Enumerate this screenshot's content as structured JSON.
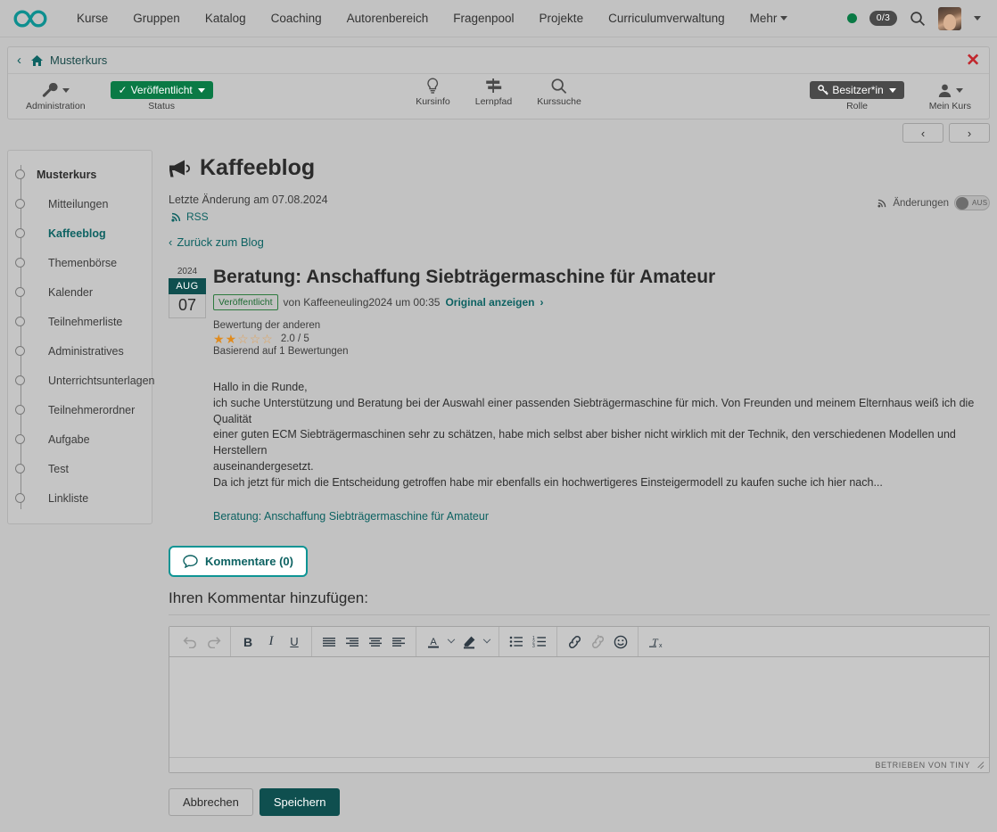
{
  "topnav": {
    "logo_icon": "infinity-logo",
    "items": [
      {
        "label": "Kurse",
        "has_caret": false
      },
      {
        "label": "Gruppen",
        "has_caret": false
      },
      {
        "label": "Katalog",
        "has_caret": false
      },
      {
        "label": "Coaching",
        "has_caret": false
      },
      {
        "label": "Autorenbereich",
        "has_caret": false
      },
      {
        "label": "Fragenpool",
        "has_caret": false
      },
      {
        "label": "Projekte",
        "has_caret": false
      },
      {
        "label": "Curriculumverwaltung",
        "has_caret": false
      },
      {
        "label": "Mehr",
        "has_caret": true
      }
    ],
    "task_badge": "0/3",
    "search_icon": "search-icon",
    "status_dot_color": "#0a7a45"
  },
  "course_header": {
    "back_icon": "chevron-left-icon",
    "home_icon": "home-icon",
    "course_name": "Musterkurs",
    "close_icon": "close-icon",
    "tools": {
      "administration": {
        "label": "Administration",
        "icon": "wrench-icon"
      },
      "status": {
        "label": "Status",
        "value": "Veröffentlicht",
        "check": "✓"
      },
      "kursinfo": {
        "label": "Kursinfo",
        "icon": "lightbulb-icon"
      },
      "lernpfad": {
        "label": "Lernpfad",
        "icon": "signpost-icon"
      },
      "kurssuche": {
        "label": "Kurssuche",
        "icon": "search-icon"
      },
      "rolle": {
        "label": "Rolle",
        "value": "Besitzer*in",
        "icon": "key-icon"
      },
      "mein_kurs": {
        "label": "Mein Kurs",
        "icon": "person-icon"
      }
    },
    "pager": {
      "prev": "‹",
      "next": "›"
    }
  },
  "sidebar": {
    "items": [
      {
        "label": "Musterkurs",
        "level": "root",
        "active": false
      },
      {
        "label": "Mitteilungen",
        "level": "child",
        "active": false
      },
      {
        "label": "Kaffeeblog",
        "level": "child",
        "active": true
      },
      {
        "label": "Themenbörse",
        "level": "child",
        "active": false
      },
      {
        "label": "Kalender",
        "level": "child",
        "active": false
      },
      {
        "label": "Teilnehmerliste",
        "level": "child",
        "active": false
      },
      {
        "label": "Administratives",
        "level": "child",
        "active": false
      },
      {
        "label": "Unterrichtsunterlagen",
        "level": "child",
        "active": false
      },
      {
        "label": "Teilnehmerordner",
        "level": "child",
        "active": false
      },
      {
        "label": "Aufgabe",
        "level": "child",
        "active": false
      },
      {
        "label": "Test",
        "level": "child",
        "active": false
      },
      {
        "label": "Linkliste",
        "level": "child",
        "active": false
      }
    ]
  },
  "main": {
    "title": "Kaffeeblog",
    "title_icon": "megaphone-icon",
    "last_change": "Letzte Änderung am 07.08.2024",
    "rss_label": "RSS",
    "rss_icon": "rss-icon",
    "changes_label": "Änderungen",
    "changes_icon": "rss-icon",
    "changes_state": "AUS",
    "back_to_blog": "Zurück zum Blog",
    "back_icon": "chevron-left-icon"
  },
  "post": {
    "date": {
      "year": "2024",
      "month": "AUG",
      "day": "07"
    },
    "title": "Beratung: Anschaffung Siebträgermaschine für Amateur",
    "status_badge": "Veröffentlicht",
    "byline": "von Kaffeeneuling2024 um 00:35",
    "original_link": "Original anzeigen",
    "original_link_icon": "chevron-right-icon",
    "rating": {
      "caption": "Bewertung der anderen",
      "value": "2.0 / 5",
      "filled": 2,
      "total": 5,
      "basis": "Basierend auf 1 Bewertungen",
      "star_color": "#e08b1e"
    },
    "text_lines": [
      "Hallo in die Runde,",
      "ich suche Unterstützung und Beratung bei der Auswahl einer passenden Siebträgermaschine für mich. Von Freunden und meinem Elternhaus weiß ich die Qualität",
      "einer guten ECM Siebträgermaschinen sehr zu schätzen, habe mich selbst aber bisher nicht wirklich mit der Technik, den verschiedenen Modellen und Herstellern",
      "auseinandergesetzt.",
      "Da ich jetzt für mich die Entscheidung getroffen habe mir ebenfalls ein hochwertigeres Einsteigermodell zu kaufen suche ich hier nach..."
    ],
    "post_link": "Beratung: Anschaffung Siebträgermaschine für Amateur"
  },
  "comments": {
    "tab_label": "Kommentare (0)",
    "tab_icon": "comment-bubble-icon",
    "tab_accent": "#0e9494",
    "heading": "Ihren Kommentar hinzufügen:"
  },
  "editor": {
    "groups": [
      {
        "buttons": [
          {
            "name": "undo-icon",
            "glyph": "↶",
            "disabled": true
          },
          {
            "name": "redo-icon",
            "glyph": "↷",
            "disabled": true
          }
        ]
      },
      {
        "buttons": [
          {
            "name": "bold-icon",
            "glyph": "B",
            "disabled": false
          },
          {
            "name": "italic-icon",
            "glyph": "I",
            "disabled": false
          },
          {
            "name": "underline-icon",
            "glyph": "U",
            "disabled": false
          }
        ]
      },
      {
        "buttons": [
          {
            "name": "align-justify-icon",
            "glyph": "",
            "disabled": false
          },
          {
            "name": "align-right-icon",
            "glyph": "",
            "disabled": false
          },
          {
            "name": "align-center-icon",
            "glyph": "",
            "disabled": false
          },
          {
            "name": "align-left-icon",
            "glyph": "",
            "disabled": false
          }
        ]
      },
      {
        "buttons": [
          {
            "name": "text-color-icon",
            "glyph": "A",
            "disabled": false
          },
          {
            "name": "text-color-chevron-icon",
            "glyph": "",
            "disabled": false
          },
          {
            "name": "highlight-color-icon",
            "glyph": "",
            "disabled": false
          },
          {
            "name": "highlight-color-chevron-icon",
            "glyph": "",
            "disabled": false
          }
        ]
      },
      {
        "buttons": [
          {
            "name": "bullet-list-icon",
            "glyph": "",
            "disabled": false
          },
          {
            "name": "numbered-list-icon",
            "glyph": "",
            "disabled": false
          }
        ]
      },
      {
        "buttons": [
          {
            "name": "insert-link-icon",
            "glyph": "",
            "disabled": false
          },
          {
            "name": "remove-link-icon",
            "glyph": "",
            "disabled": true
          },
          {
            "name": "emoticon-icon",
            "glyph": "☺",
            "disabled": false
          }
        ]
      },
      {
        "buttons": [
          {
            "name": "clear-formatting-icon",
            "glyph": "",
            "disabled": false
          }
        ]
      }
    ],
    "content": "",
    "brand": "BETRIEBEN VON TINY",
    "resize_icon": "resize-handle-icon"
  },
  "actions": {
    "cancel": "Abbrechen",
    "save": "Speichern"
  }
}
